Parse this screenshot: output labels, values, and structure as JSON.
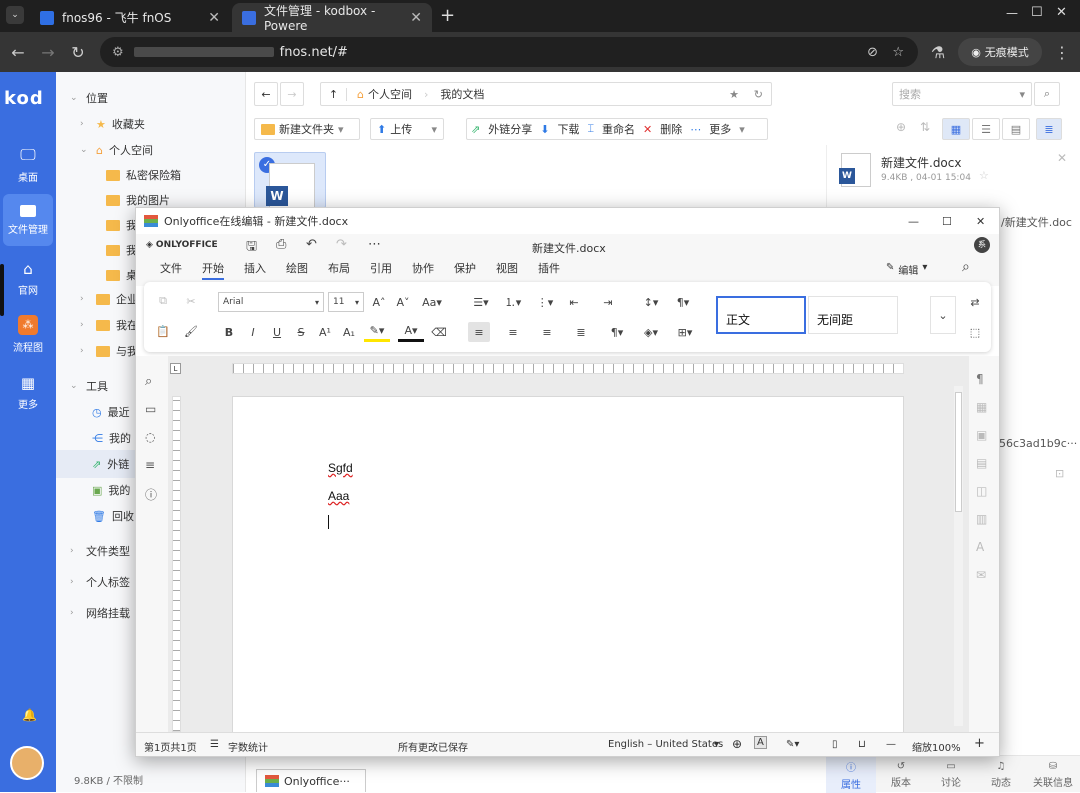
{
  "browser": {
    "tabs": [
      {
        "title": "fnos96 - 飞牛 fnOS"
      },
      {
        "title": "文件管理 - kodbox - Powere"
      }
    ],
    "address": "fnos.net/#",
    "incognito_label": "无痕模式"
  },
  "kod": {
    "logo": "kod",
    "side_items": [
      {
        "label": "桌面"
      },
      {
        "label": "文件管理"
      },
      {
        "label": "官网"
      },
      {
        "label": "流程图"
      },
      {
        "label": "更多"
      }
    ],
    "tree": [
      {
        "label": "位置"
      },
      {
        "label": "收藏夹"
      },
      {
        "label": "个人空间"
      },
      {
        "label": "私密保险箱"
      },
      {
        "label": "我的图片"
      },
      {
        "label": "我"
      },
      {
        "label": "我"
      },
      {
        "label": "桌"
      },
      {
        "label": "企业"
      },
      {
        "label": "我在"
      },
      {
        "label": "与我"
      },
      {
        "label": "工具"
      },
      {
        "label": "最近"
      },
      {
        "label": "我的"
      },
      {
        "label": "外链"
      },
      {
        "label": "我的"
      },
      {
        "label": "回收"
      },
      {
        "label": "文件类型"
      },
      {
        "label": "个人标签"
      },
      {
        "label": "网络挂载"
      }
    ],
    "footer": "9.8KB / 不限制",
    "breadcrumb": [
      "个人空间",
      "我的文档"
    ],
    "search_placeholder": "搜索",
    "toolbar": {
      "new_folder": "新建文件夹",
      "upload": "上传",
      "share": "外链分享",
      "download": "下载",
      "rename": "重命名",
      "delete": "删除",
      "more": "更多"
    },
    "file_preview": {
      "name": "新建文件.docx",
      "meta": "9.4KB , 04-01 15:04"
    },
    "right_snippets": [
      "/新建文件.doc",
      "56c3ad1b9c···"
    ],
    "bottom_tabs": [
      {
        "label": "属性"
      },
      {
        "label": "版本"
      },
      {
        "label": "讨论"
      },
      {
        "label": "动态"
      },
      {
        "label": "关联信息"
      }
    ],
    "taskbar": "Onlyoffice···"
  },
  "editor": {
    "window_title": "Onlyoffice在线编辑 - 新建文件.docx",
    "brand": "ONLYOFFICE",
    "doc_title": "新建文件.docx",
    "user_initial": "系",
    "menus": [
      {
        "label": "文件"
      },
      {
        "label": "开始"
      },
      {
        "label": "插入"
      },
      {
        "label": "绘图"
      },
      {
        "label": "布局"
      },
      {
        "label": "引用"
      },
      {
        "label": "协作"
      },
      {
        "label": "保护"
      },
      {
        "label": "视图"
      },
      {
        "label": "插件"
      }
    ],
    "edit_mode": "编辑",
    "font_name": "Arial",
    "font_size": "11",
    "styles": [
      "正文",
      "无间距"
    ],
    "doc_lines": [
      "Sgfd",
      "Aaa"
    ],
    "status": {
      "page": "第1页共1页",
      "wordcount": "字数统计",
      "saved": "所有更改已保存",
      "language": "English – United States",
      "zoom": "缩放100%"
    }
  }
}
